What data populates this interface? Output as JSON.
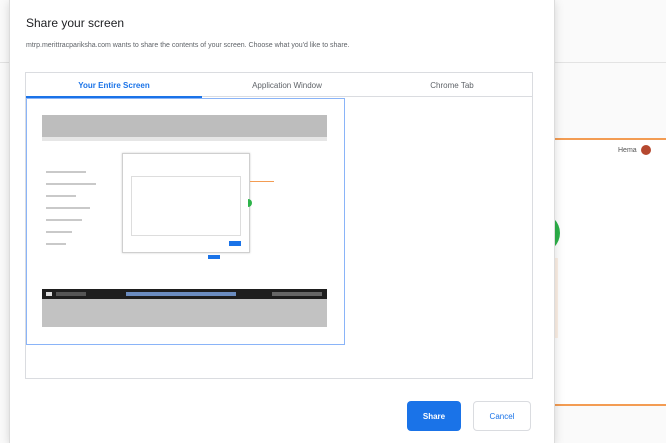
{
  "dialog": {
    "title": "Share your screen",
    "subtitle": "mtrp.merittracpariksha.com wants to share the contents of your screen. Choose what you'd like to share.",
    "tabs": [
      {
        "label": "Your Entire Screen",
        "active": true
      },
      {
        "label": "Application Window",
        "active": false
      },
      {
        "label": "Chrome Tab",
        "active": false
      }
    ],
    "share_label": "Share",
    "cancel_label": "Cancel"
  },
  "background": {
    "user_label": "Hema"
  },
  "colors": {
    "accent": "#1a73e8",
    "orange": "#f39c53",
    "green": "#2db34a"
  }
}
